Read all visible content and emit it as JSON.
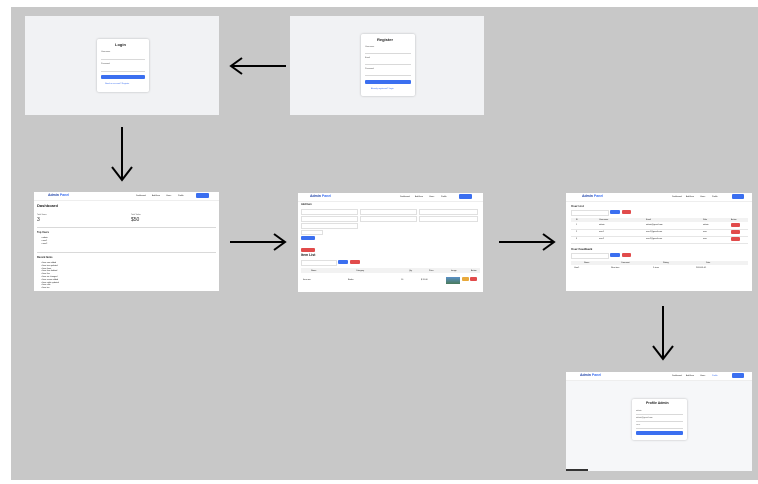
{
  "login": {
    "title": "Login",
    "username_label": "Username",
    "password_label": "Password",
    "submit": "Login",
    "footer": "Need an account? Register"
  },
  "register": {
    "title": "Register",
    "username_label": "Username",
    "email_label": "Email",
    "password_label": "Password",
    "submit": "Register",
    "footer": "Already registered? Login"
  },
  "nav": {
    "brand_a": "Admin",
    "brand_b": "Panel",
    "links": [
      "Dashboard",
      "Add Item",
      "Users",
      "Profile"
    ],
    "logout": "Logout"
  },
  "dashboard": {
    "title": "Dashboard",
    "stat1_label": "Total Items",
    "stat1_value": "3",
    "stat2_label": "Total Value",
    "stat2_value": "$50",
    "list1_title": "Top Users",
    "list1_items": [
      "admin",
      "user1",
      "user2"
    ],
    "list2_title": "Recent Items",
    "list2_items": [
      "Item one added",
      "Item two updated",
      "Item three",
      "Item four deleted",
      "Item five",
      "Item six changed",
      "Item seven added",
      "Item eight updated",
      "Item nine",
      "Item ten"
    ]
  },
  "additem": {
    "section_title": "Add Item",
    "list_title": "Item List",
    "headers": [
      "Name",
      "Category",
      "Qty",
      "Price",
      "Image",
      "Action"
    ],
    "row": [
      "Item one",
      "Books",
      "10",
      "$ 20.00",
      "",
      ""
    ],
    "save": "Save",
    "search": "Search"
  },
  "users": {
    "title": "User List",
    "headers": [
      "ID",
      "Username",
      "Email",
      "Role",
      "Action"
    ],
    "rows": [
      [
        "1",
        "admin",
        "admin@gmail.com",
        "admin"
      ],
      [
        "2",
        "user1",
        "user1@gmail.com",
        "user"
      ],
      [
        "3",
        "user2",
        "user2@gmail.com",
        "user"
      ]
    ],
    "feedback_title": "User Feedback",
    "fb_headers": [
      "Name",
      "Comment",
      "Rating",
      "Date"
    ],
    "fb_row": [
      "User1",
      "Nice item",
      "5 stars",
      "2024-01-01"
    ]
  },
  "profile": {
    "title": "Profile Admin",
    "username": "admin",
    "email": "admin@gmail.com",
    "password": "••••••",
    "save": "Update"
  }
}
